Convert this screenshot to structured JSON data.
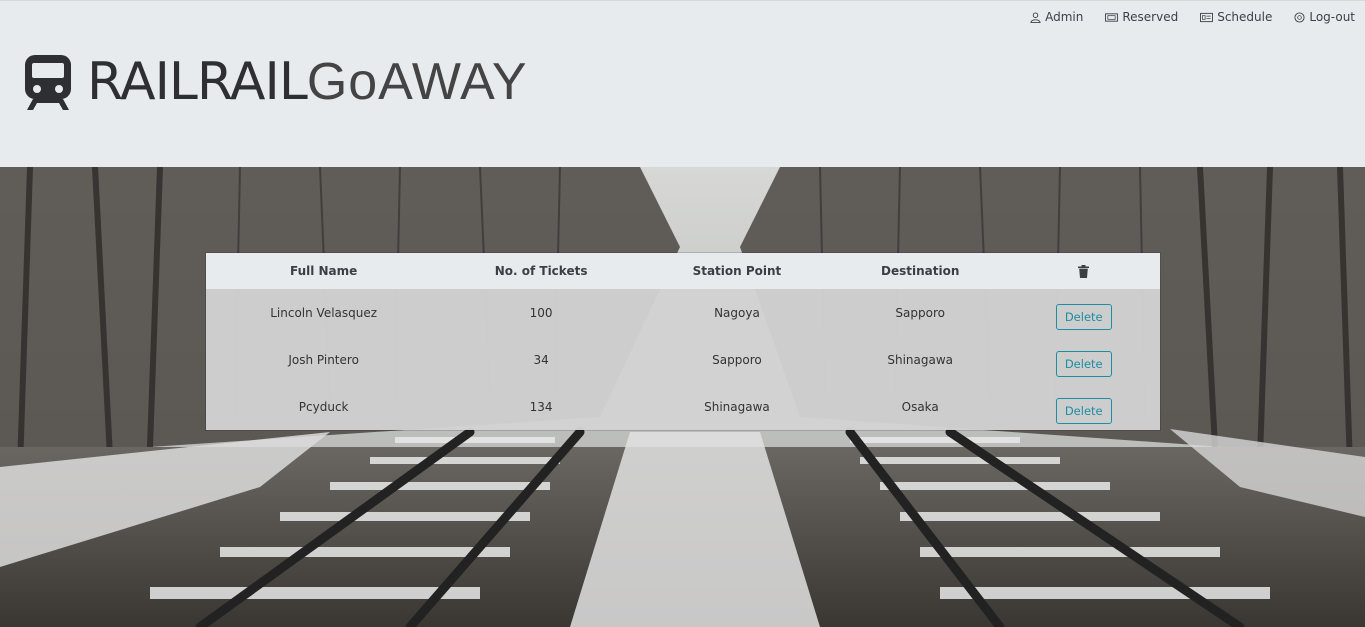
{
  "nav": {
    "admin": "Admin",
    "reserved": "Reserved",
    "schedule": "Schedule",
    "logout": "Log-out"
  },
  "brand": {
    "part1": "RAILRAIL",
    "part2": "GoAWAY"
  },
  "table": {
    "headers": {
      "name": "Full Name",
      "tickets": "No. of Tickets",
      "station": "Station Point",
      "destination": "Destination"
    },
    "rows": [
      {
        "name": "Lincoln Velasquez",
        "tickets": "100",
        "station": "Nagoya",
        "destination": "Sapporo",
        "action": "Delete"
      },
      {
        "name": "Josh Pintero",
        "tickets": "34",
        "station": "Sapporo",
        "destination": "Shinagawa",
        "action": "Delete"
      },
      {
        "name": "Pcyduck",
        "tickets": "134",
        "station": "Shinagawa",
        "destination": "Osaka",
        "action": "Delete"
      }
    ]
  },
  "icons": {
    "admin": "user-icon",
    "reserved": "ticket-icon",
    "schedule": "schedule-card-icon",
    "logout": "logout-icon",
    "delete_header": "trash-icon",
    "logo": "train-icon"
  },
  "colors": {
    "header_bg": "#e8ebee",
    "accent": "#1b8ea1",
    "text": "#333333"
  }
}
